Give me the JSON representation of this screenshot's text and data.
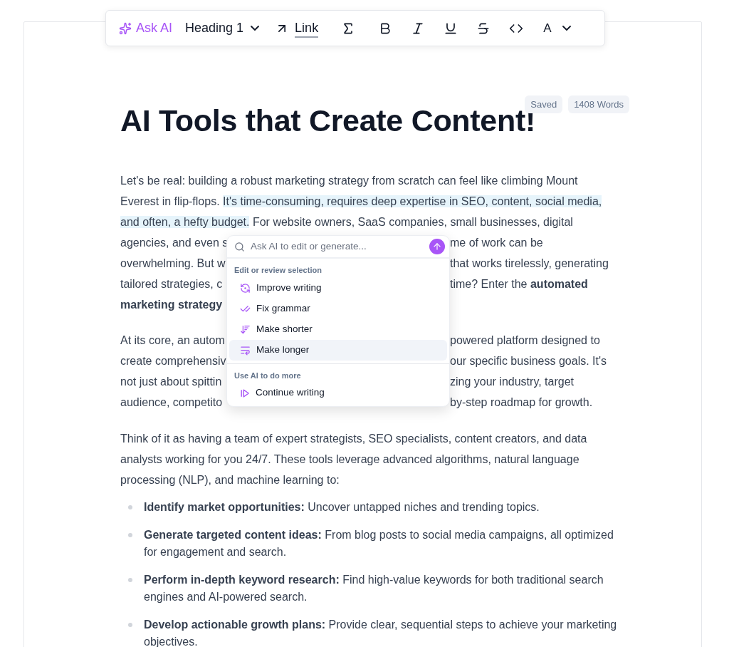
{
  "toolbar": [
    {
      "kind": "ai",
      "label": "Ask AI"
    },
    {
      "kind": "dropdown",
      "label": "Heading 1"
    },
    {
      "kind": "link",
      "label": "Link"
    },
    {
      "kind": "sigma"
    },
    {
      "kind": "bold"
    },
    {
      "kind": "italic"
    },
    {
      "kind": "underline"
    },
    {
      "kind": "strike"
    },
    {
      "kind": "code"
    },
    {
      "kind": "color",
      "label": "A"
    }
  ],
  "badges": [
    "Saved",
    "1408 Words"
  ],
  "title": "AI Tools that Create Content!",
  "paragraph_1": [
    {
      "kind": "full",
      "segments": [
        {
          "text": "Let's be real: building a robust marketing strategy from scratch can feel like climbing Mount",
          "highlighted": false
        }
      ]
    },
    {
      "kind": "full",
      "segments": [
        {
          "text": "Everest in flip-flops. ",
          "highlighted": false
        },
        {
          "text": "It's time-consuming, requires deep expertise in SEO, content, social media,",
          "highlighted": true
        }
      ]
    },
    {
      "kind": "full",
      "segments": [
        {
          "text": "and often, a hefty budget.",
          "highlighted": true
        },
        {
          "text": " For website owners, SaaS companies, small businesses, digital",
          "highlighted": false
        }
      ]
    },
    {
      "kind": "split",
      "left": "agencies, and even s",
      "right": "me of work can be"
    },
    {
      "kind": "split",
      "left": "overwhelming. But w",
      "right": "that works tirelessly, generating"
    },
    {
      "kind": "split",
      "left": "tailored strategies, c",
      "right": "time? Enter the **automated**"
    },
    {
      "kind": "split",
      "left": "**marketing strategy**"
    }
  ],
  "paragraph_2": [
    {
      "kind": "split",
      "left": "At its core, an autom",
      "right": "powered platform designed to"
    },
    {
      "kind": "split",
      "left": "create comprehensiv",
      "right": "our specific business goals. It's"
    },
    {
      "kind": "split",
      "left": "not just about spittin",
      "right": "zing your industry, target"
    },
    {
      "kind": "split",
      "left": "audience, competito",
      "right": "by-step roadmap for growth."
    }
  ],
  "paragraph_3": "Think of it as having a team of expert strategists, SEO specialists, content creators, and data analysts working for you 24/7. These tools leverage advanced algorithms, natural language processing (NLP), and machine learning to:",
  "bullets": [
    "**Identify market opportunities:** Uncover untapped niches and trending topics.",
    "**Generate targeted content ideas:** From blog posts to social media campaigns, all optimized for engagement and search.",
    "**Perform in-depth keyword research:** Find high-value keywords for both traditional search engines and AI-powered search.",
    "**Develop actionable growth plans:** Provide clear, sequential steps to achieve your marketing objectives."
  ],
  "ai_menu": {
    "search": {
      "placeholder": "Ask AI to edit or generate..."
    },
    "sections": [
      {
        "heading": "Edit or review selection",
        "items": [
          {
            "kind": "improve",
            "label": "Improve writing",
            "selected": false
          },
          {
            "kind": "grammar",
            "label": "Fix grammar",
            "selected": false
          },
          {
            "kind": "shorter",
            "label": "Make shorter",
            "selected": false
          },
          {
            "kind": "longer",
            "label": "Make longer",
            "selected": true
          }
        ]
      },
      {
        "heading": "Use AI to do more",
        "items": [
          {
            "kind": "continue",
            "label": "Continue writing",
            "selected": false
          }
        ]
      }
    ]
  }
}
